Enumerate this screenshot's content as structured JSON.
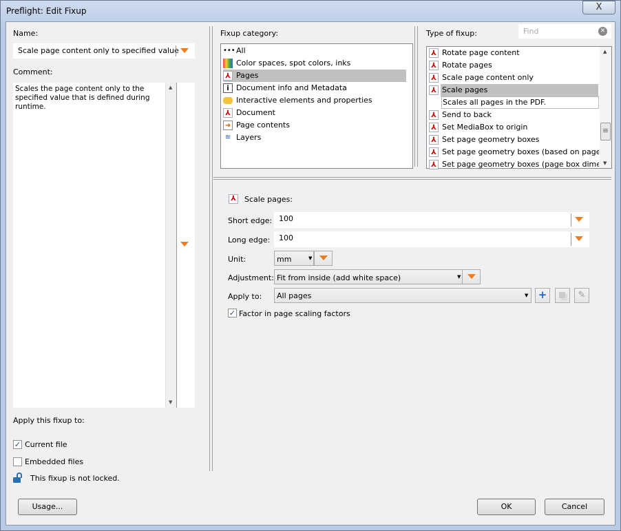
{
  "window": {
    "title": "Preflight: Edit Fixup",
    "close": "X"
  },
  "left": {
    "name_label": "Name:",
    "name_value": "Scale page content only to specified value",
    "comment_label": "Comment:",
    "comment_value": "Scales the page content only to the specified value that is defined during runtime.",
    "apply_label": "Apply this fixup to:",
    "current_file": {
      "label": "Current file",
      "checked": true
    },
    "embedded_files": {
      "label": "Embedded files",
      "checked": false
    },
    "lock_text": "This fixup is not locked.",
    "usage_button": "Usage..."
  },
  "category": {
    "label": "Fixup category:",
    "items": [
      {
        "label": "All",
        "icon": "dots"
      },
      {
        "label": "Color spaces, spot colors, inks",
        "icon": "color"
      },
      {
        "label": "Pages",
        "icon": "pdf",
        "selected": true
      },
      {
        "label": "Document info and Metadata",
        "icon": "info"
      },
      {
        "label": "Interactive elements and properties",
        "icon": "comment"
      },
      {
        "label": "Document",
        "icon": "pdf"
      },
      {
        "label": "Page contents",
        "icon": "arrow"
      },
      {
        "label": "Layers",
        "icon": "layers"
      }
    ]
  },
  "type": {
    "label": "Type of fixup:",
    "find_placeholder": "Find",
    "items": [
      {
        "label": "Rotate page content"
      },
      {
        "label": "Rotate pages"
      },
      {
        "label": "Scale page content only"
      },
      {
        "label": "Scale pages",
        "selected": true
      },
      {
        "label": "Scales all pages in the PDF.",
        "description": true
      },
      {
        "label": "Send to back"
      },
      {
        "label": "Set MediaBox to origin"
      },
      {
        "label": "Set page geometry boxes"
      },
      {
        "label": "Set page geometry boxes (based on page co"
      },
      {
        "label": "Set page geometry boxes (page box dimensi"
      }
    ]
  },
  "details": {
    "heading": "Scale pages:",
    "short_edge_label": "Short edge:",
    "short_edge": "100",
    "long_edge_label": "Long edge:",
    "long_edge": "100",
    "unit_label": "Unit:",
    "unit": "mm",
    "adjustment_label": "Adjustment:",
    "adjustment": "Fit from inside (add white space)",
    "apply_to_label": "Apply to:",
    "apply_to": "All pages",
    "factor_label": "Factor in page scaling factors",
    "factor_checked": true
  },
  "footer": {
    "ok": "OK",
    "cancel": "Cancel"
  }
}
